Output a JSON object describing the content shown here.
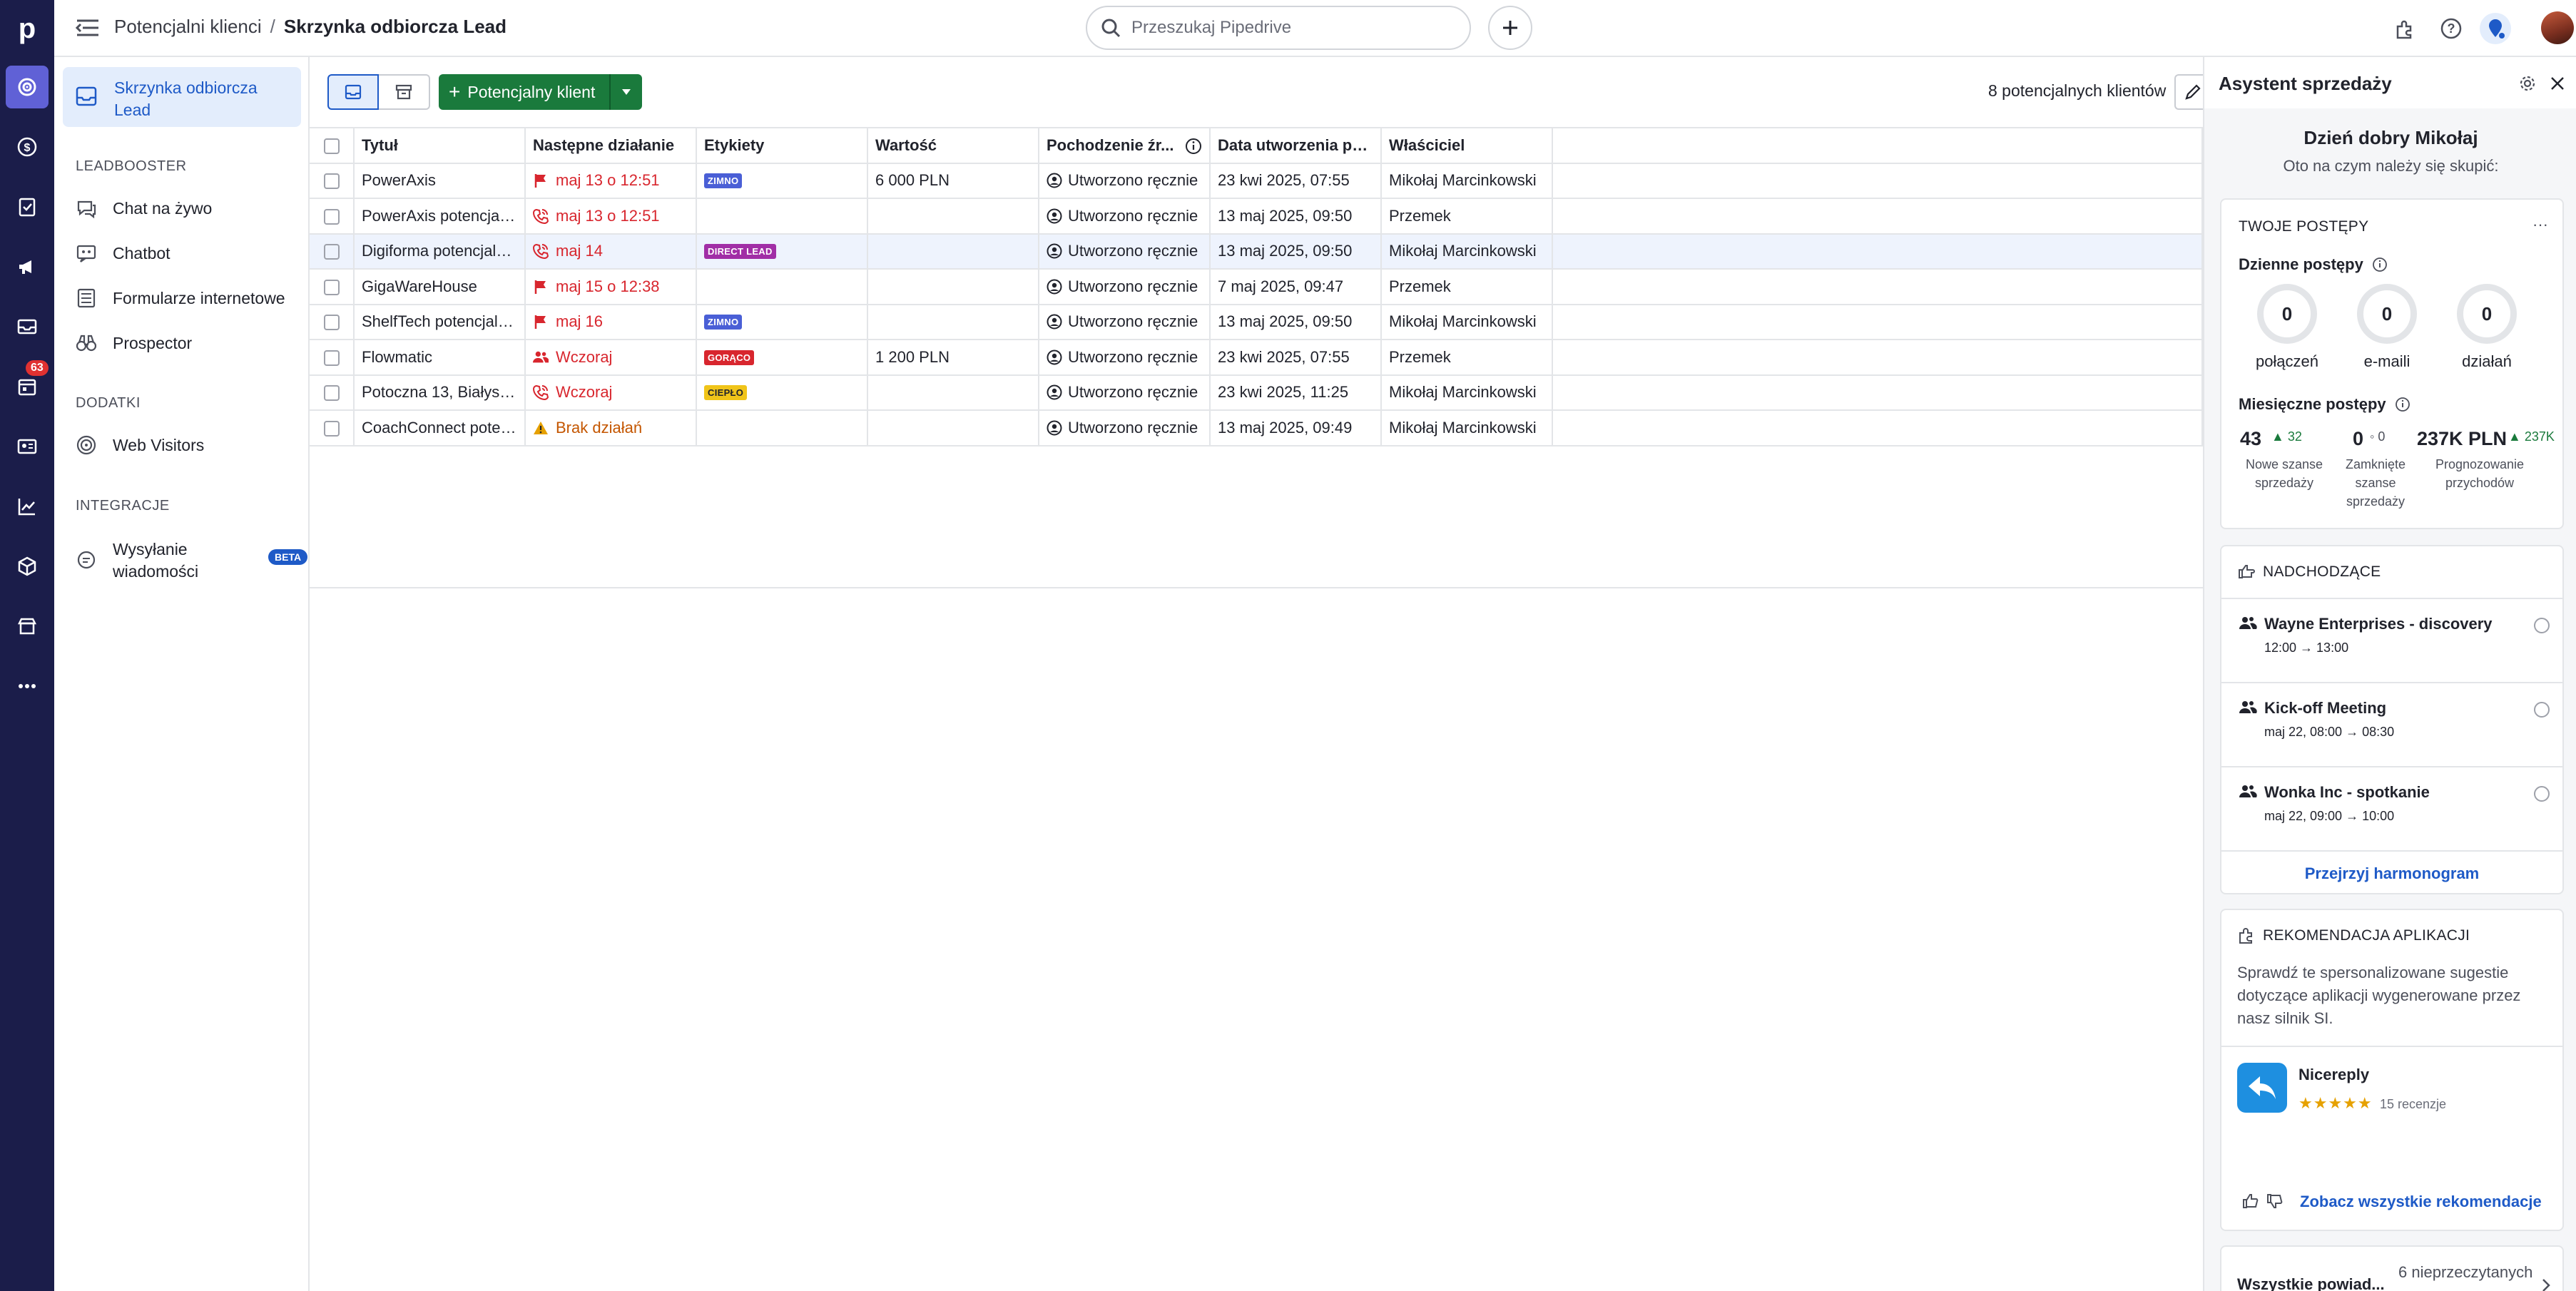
{
  "header": {
    "breadcrumb_parent": "Potencjalni klienci",
    "breadcrumb_separator": "/",
    "breadcrumb_current": "Skrzynka odbiorcza Lead",
    "search_placeholder": "Przeszukaj Pipedrive"
  },
  "rail": {
    "logo": "p",
    "badge_count": "63"
  },
  "sidebar": {
    "active_item": "Skrzynka odbiorcza Lead",
    "sections": [
      {
        "title": "LEADBOOSTER",
        "items": [
          "Chat na żywo",
          "Chatbot",
          "Formularze internetowe",
          "Prospector"
        ]
      },
      {
        "title": "DODATKI",
        "items": [
          "Web Visitors"
        ]
      },
      {
        "title": "INTEGRACJE",
        "items": [
          "Wysyłanie wiadomości"
        ]
      }
    ],
    "beta_label": "BETA"
  },
  "toolbar": {
    "add_button_label": "Potencjalny klient",
    "lead_count": "8 potencjalnych klientów"
  },
  "table": {
    "columns": [
      "Tytuł",
      "Następne działanie",
      "Etykiety",
      "Wartość",
      "Pochodzenie źr...",
      "Data utworzenia po...",
      "Właściciel"
    ],
    "rows": [
      {
        "title": "PowerAxis",
        "action": "maj 13 o 12:51",
        "action_type": "flag",
        "action_color": "red",
        "tag": "ZIMNO",
        "tag_color": "#4a5fd6",
        "value": "6 000 PLN",
        "origin": "Utworzono ręcznie",
        "created": "23 kwi 2025, 07:55",
        "owner": "Mikołaj Marcinkowski",
        "selected": false
      },
      {
        "title": "PowerAxis potencjalny kli...",
        "action": "maj 13 o 12:51",
        "action_type": "phone",
        "action_color": "red",
        "tag": "",
        "tag_color": "",
        "value": "",
        "origin": "Utworzono ręcznie",
        "created": "13 maj 2025, 09:50",
        "owner": "Przemek",
        "selected": false
      },
      {
        "title": "Digiforma potencjalny klie...",
        "action": "maj 14",
        "action_type": "phone",
        "action_color": "red",
        "tag": "DIRECT LEAD",
        "tag_color": "#a12ea6",
        "value": "",
        "origin": "Utworzono ręcznie",
        "created": "13 maj 2025, 09:50",
        "owner": "Mikołaj Marcinkowski",
        "selected": true
      },
      {
        "title": "GigaWareHouse",
        "action": "maj 15 o 12:38",
        "action_type": "flag",
        "action_color": "red",
        "tag": "",
        "tag_color": "",
        "value": "",
        "origin": "Utworzono ręcznie",
        "created": "7 maj 2025, 09:47",
        "owner": "Przemek",
        "selected": false
      },
      {
        "title": "ShelfTech potencjalny kli...",
        "action": "maj 16",
        "action_type": "flag",
        "action_color": "red",
        "tag": "ZIMNO",
        "tag_color": "#4a5fd6",
        "value": "",
        "origin": "Utworzono ręcznie",
        "created": "13 maj 2025, 09:50",
        "owner": "Mikołaj Marcinkowski",
        "selected": false
      },
      {
        "title": "Flowmatic",
        "action": "Wczoraj",
        "action_type": "people",
        "action_color": "red",
        "tag": "GORĄCO",
        "tag_color": "#d8262e",
        "value": "1 200 PLN",
        "origin": "Utworzono ręcznie",
        "created": "23 kwi 2025, 07:55",
        "owner": "Przemek",
        "selected": false
      },
      {
        "title": "Potoczna 13, Białystok po...",
        "action": "Wczoraj",
        "action_type": "phone",
        "action_color": "red",
        "tag": "CIEPŁO",
        "tag_color": "#f0c419",
        "value": "",
        "origin": "Utworzono ręcznie",
        "created": "23 kwi 2025, 11:25",
        "owner": "Mikołaj Marcinkowski",
        "selected": false
      },
      {
        "title": "CoachConnect potencjal...",
        "action": "Brak działań",
        "action_type": "warning",
        "action_color": "orange",
        "tag": "",
        "tag_color": "",
        "value": "",
        "origin": "Utworzono ręcznie",
        "created": "13 maj 2025, 09:49",
        "owner": "Mikołaj Marcinkowski",
        "selected": false
      }
    ]
  },
  "panel": {
    "title": "Asystent sprzedaży",
    "greeting": "Dzień dobry Mikołaj",
    "subgreeting": "Oto na czym należy się skupić:",
    "progress": {
      "title": "TWOJE POSTĘPY",
      "daily_title": "Dzienne postępy",
      "daily": [
        {
          "value": "0",
          "label": "połączeń"
        },
        {
          "value": "0",
          "label": "e-maili"
        },
        {
          "value": "0",
          "label": "działań"
        }
      ],
      "monthly_title": "Miesięczne postępy",
      "monthly": [
        {
          "value": "43",
          "delta": "32",
          "label": "Nowe szanse sprzedaży"
        },
        {
          "value": "0",
          "delta": "0",
          "label": "Zamknięte szanse sprzedaży"
        },
        {
          "value": "237K PLN",
          "delta": "237K",
          "label": "Prognozowanie przychodów"
        }
      ]
    },
    "upcoming": {
      "title": "NADCHODZĄCE",
      "events": [
        {
          "title": "Wayne Enterprises - discovery",
          "time": "12:00 → 13:00"
        },
        {
          "title": "Kick-off Meeting",
          "time": "maj 22, 08:00 → 08:30"
        },
        {
          "title": "Wonka Inc - spotkanie",
          "time": "maj 22, 09:00 → 10:00"
        }
      ],
      "link": "Przejrzyj harmonogram"
    },
    "recommendations": {
      "title": "REKOMENDACJA APLIKACJI",
      "description": "Sprawdź te spersonalizowane sugestie dotyczące aplikacji wygenerowane przez nasz silnik SI.",
      "app_name": "Nicereply",
      "stars": "★★★★★",
      "rating": 5,
      "reviews": "15 recenzje",
      "link": "Zobacz wszystkie rekomendacje"
    },
    "notifications": {
      "label": "Wszystkie powiad...",
      "count": "6 nieprzeczytanych"
    }
  },
  "colors": {
    "rail_bg": "#1b1d4a",
    "accent_blue": "#1e5ac7",
    "green_button": "#1a7a3c",
    "alert_red": "#d8262e"
  }
}
